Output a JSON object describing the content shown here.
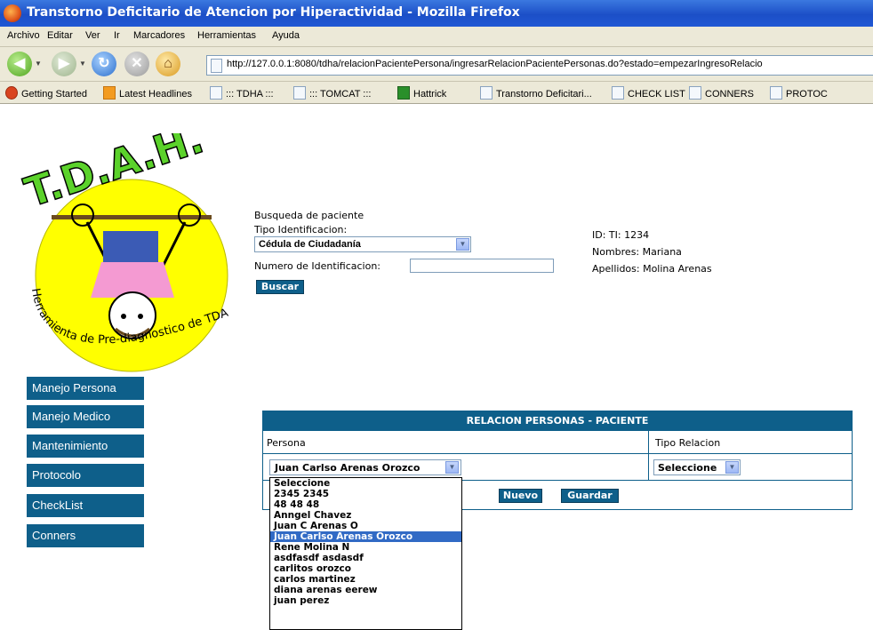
{
  "window": {
    "title": "Transtorno Deficitario de Atencion por Hiperactividad - Mozilla Firefox"
  },
  "menu": [
    "Archivo",
    "Editar",
    "Ver",
    "Ir",
    "Marcadores",
    "Herramientas",
    "Ayuda"
  ],
  "address": {
    "url": "http://127.0.0.1:8080/tdha/relacionPacientePersona/ingresarRelacionPacientePersonas.do?estado=empezarIngresoRelacio"
  },
  "bookmarks": [
    "Getting Started",
    "Latest Headlines",
    "::: TDHA :::",
    "::: TOMCAT :::",
    "Hattrick",
    "Transtorno Deficitari...",
    "CHECK LIST",
    "CONNERS",
    "PROTOC"
  ],
  "logo": {
    "letters": "T.D.A.H.",
    "tagline": "Herramienta de Pre-diagnostico de TDAH"
  },
  "sidebar": {
    "items": [
      "Manejo Persona",
      "Manejo Medico",
      "Mantenimiento",
      "Protocolo",
      "CheckList",
      "Conners"
    ]
  },
  "search": {
    "heading": "Busqueda de paciente",
    "tipo_label": "Tipo Identificacion:",
    "tipo_value": "Cédula de Ciudadanía",
    "numero_label": "Numero de Identificacion:",
    "numero_value": "",
    "buscar_label": "Buscar"
  },
  "patient": {
    "id": "ID: TI: 1234",
    "nombres": "Nombres: Mariana",
    "apellidos": "Apellidos: Molina Arenas"
  },
  "relation": {
    "title": "RELACION PERSONAS - PACIENTE",
    "col_persona": "Persona",
    "col_tipo": "Tipo Relacion",
    "persona_value": "Juan Carlso Arenas Orozco",
    "tipo_value": "Seleccione",
    "nuevo_label": "Nuevo",
    "guardar_label": "Guardar"
  },
  "dropdown": {
    "options": [
      "Seleccione",
      "2345 2345",
      "48 48 48",
      "Anngel Chavez",
      "Juan C Arenas O",
      "Juan Carlso Arenas Orozco",
      "Rene Molina N",
      "asdfasdf asdasdf",
      "carlitos orozco",
      "carlos martinez",
      "diana arenas eerew",
      "juan perez"
    ],
    "selected": "Juan Carlso Arenas Orozco"
  }
}
